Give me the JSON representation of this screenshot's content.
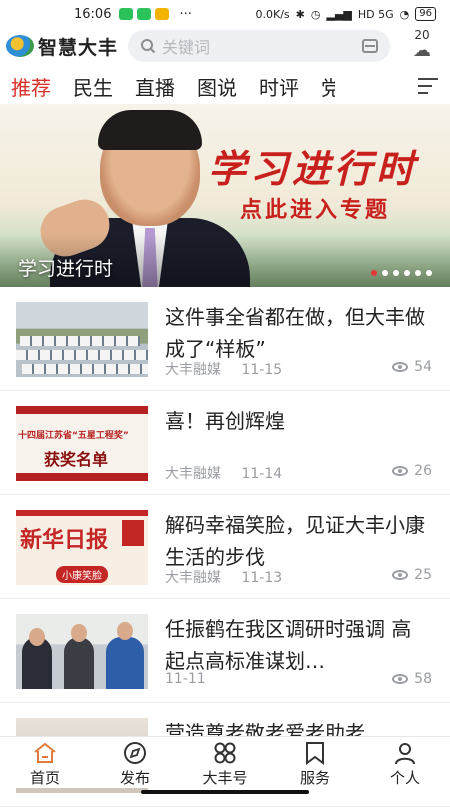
{
  "status": {
    "time": "16:06",
    "more": "···",
    "speed": "0.0K/s",
    "signal_labels": "HD 5G",
    "battery": "96"
  },
  "header": {
    "app_name": "智慧大丰",
    "search_placeholder": "关键词",
    "weather_temp": "20"
  },
  "tabs": [
    {
      "label": "推荐",
      "active": true
    },
    {
      "label": "民生"
    },
    {
      "label": "直播"
    },
    {
      "label": "图说"
    },
    {
      "label": "时评"
    },
    {
      "label": "党"
    }
  ],
  "banner": {
    "headline": "学习进行时",
    "subheadline": "点此进入专题",
    "caption": "学习进行时",
    "slide_count": 6,
    "active_slide": 1
  },
  "news": [
    {
      "title": "这件事全省都在做，但大丰做成了“样板”",
      "source": "大丰融媒",
      "date": "11-15",
      "views": "54",
      "thumb": "villas"
    },
    {
      "title": "喜！再创辉煌",
      "source": "大丰融媒",
      "date": "11-14",
      "views": "26",
      "thumb": "award",
      "thumb_text1": "十四届江苏省“五星工程奖”",
      "thumb_text2": "获奖名单"
    },
    {
      "title": "解码幸福笑脸，见证大丰小康生活的步伐",
      "source": "大丰融媒",
      "date": "11-13",
      "views": "25",
      "thumb": "paper",
      "thumb_text1": "新华日报",
      "thumb_text2": "小康笑脸"
    },
    {
      "title": "任振鹤在我区调研时强调 高起点高标准谋划…",
      "source": "",
      "date": "11-11",
      "views": "58",
      "thumb": "meeting"
    },
    {
      "title": "营造尊老敬老爱老助老",
      "source": "",
      "date": "",
      "views": "",
      "thumb": "partial"
    }
  ],
  "bottom_nav": [
    {
      "label": "首页",
      "icon": "home-icon",
      "active": true
    },
    {
      "label": "发布",
      "icon": "compass-icon"
    },
    {
      "label": "大丰号",
      "icon": "grid-icon"
    },
    {
      "label": "服务",
      "icon": "bookmark-icon"
    },
    {
      "label": "个人",
      "icon": "person-icon"
    }
  ],
  "colors": {
    "accent": "#d9302a",
    "banner_red": "#c8201c"
  }
}
